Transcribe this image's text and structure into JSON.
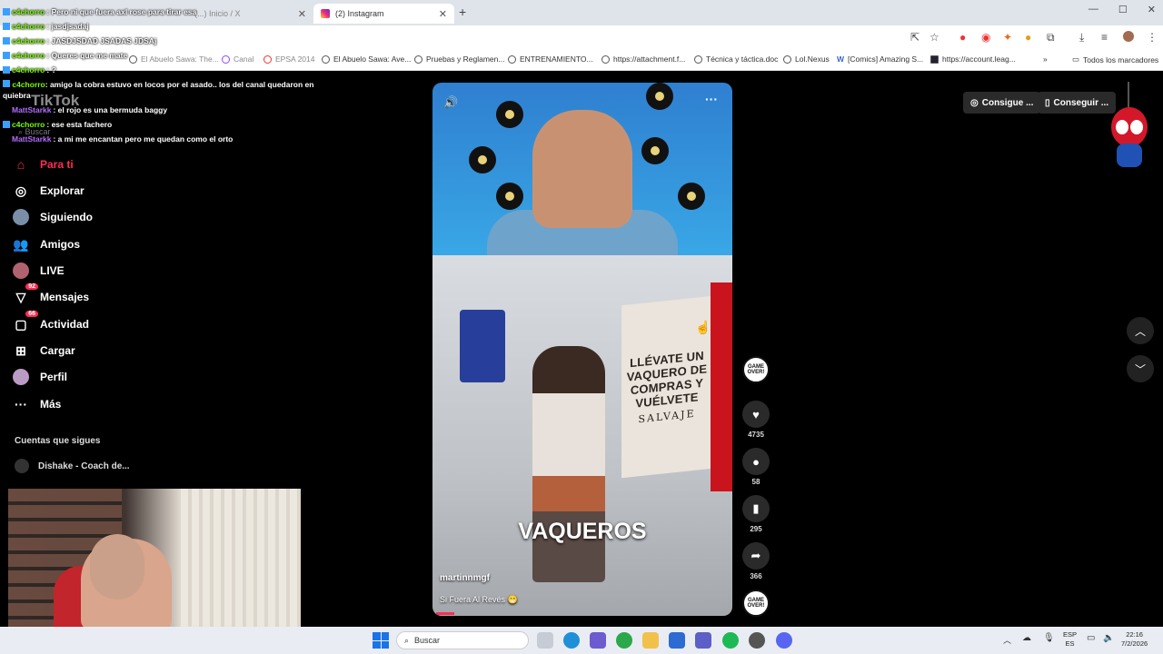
{
  "browser": {
    "tabs": [
      {
        "label": "(...) Inicio / X"
      },
      {
        "label": "(2) Instagram"
      }
    ],
    "bookmarks": [
      "El Abuelo Sawa: Ave...",
      "Pruebas y Reglamen...",
      "ENTRENAMIENTO...",
      "https://attachment.f...",
      "Técnica y táctica.doc",
      "Lol.Nexus",
      "[Comics] Amazing S...",
      "https://account.leag...",
      "Todos los marcadores"
    ],
    "bookmarks_left": [
      "El Abuelo Sawa: The...",
      "Canal",
      "EPSA 2014"
    ]
  },
  "chat": [
    {
      "user": "c4chorro",
      "text": ": Pero ni que fuera axl rose para tirar esa",
      "color": "green"
    },
    {
      "user": "c4chorro",
      "text": ": jasdjsadaj",
      "color": "green"
    },
    {
      "user": "c4chorro",
      "text": ": JASDJSDAD JSADAS JDSAj",
      "color": "green"
    },
    {
      "user": "c4chorro",
      "text": ": Queres que me mate",
      "color": "green"
    },
    {
      "user": "c4chorro",
      "text": ": ?",
      "color": "green"
    },
    {
      "user": "c4chorro",
      "text": ": amigo la cobra estuvo en locos por el asado.. los del canal quedaron en quiebra",
      "color": "green"
    },
    {
      "user": "MattStarkk",
      "text": ": el rojo es una bermuda baggy",
      "color": "purple"
    },
    {
      "user": "c4chorro",
      "text": ": ese esta fachero",
      "color": "green"
    },
    {
      "user": "MattStarkk",
      "text": ": a mi me encantan pero me quedan como el orto",
      "color": "purple"
    }
  ],
  "tiktok": {
    "logo": "TikTok",
    "search_placeholder": "Buscar",
    "nav": [
      {
        "label": "Para ti",
        "icon": "home-icon"
      },
      {
        "label": "Explorar",
        "icon": "compass-icon"
      },
      {
        "label": "Siguiendo",
        "icon": "following-avatar"
      },
      {
        "label": "Amigos",
        "icon": "friends-icon"
      },
      {
        "label": "LIVE",
        "icon": "live-icon"
      },
      {
        "label": "Mensajes",
        "icon": "messages-icon",
        "badge": "92"
      },
      {
        "label": "Actividad",
        "icon": "activity-icon",
        "badge": "66"
      },
      {
        "label": "Cargar",
        "icon": "upload-icon"
      },
      {
        "label": "Perfil",
        "icon": "profile-avatar"
      },
      {
        "label": "Más",
        "icon": "more-icon"
      }
    ],
    "following_header": "Cuentas que sigues",
    "following": [
      {
        "label": "Dishake - Coach de..."
      }
    ],
    "top_buttons": [
      "Consigue ...",
      "Conseguir ..."
    ]
  },
  "video": {
    "sign_text": "LLÉVATE UN VAQUERO DE COMPRAS Y VUÉLVETE",
    "sign_sub": "SALVAJE",
    "caption": "VAQUEROS",
    "user": "martinnmgf",
    "description": "Si Fuera Al Revés 😁",
    "disc_text": "GAME OVER!",
    "likes": "4735",
    "comments": "58",
    "saves": "295",
    "shares": "366"
  },
  "taskbar": {
    "search_placeholder": "Buscar",
    "lang_top": "ESP",
    "lang_bottom": "ES",
    "time": "22:16",
    "date": "7/2/2026"
  }
}
